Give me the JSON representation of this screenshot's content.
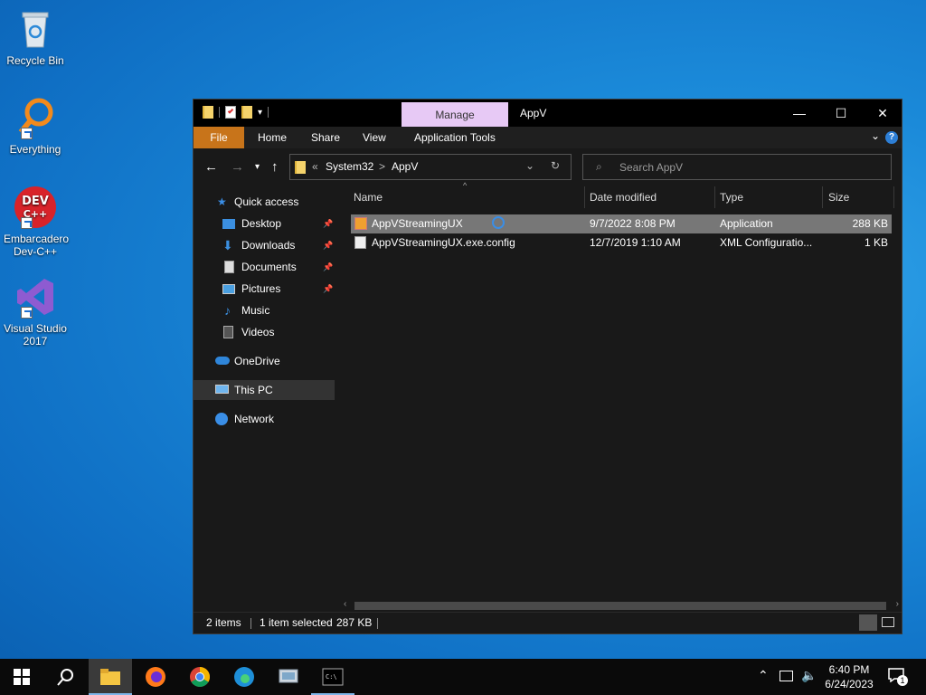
{
  "desktop": {
    "icons": [
      {
        "label": "Recycle Bin",
        "icon": "recycle-bin-icon"
      },
      {
        "label": "Everything",
        "icon": "everything-search-icon"
      },
      {
        "label": "Embarcadero Dev-C++",
        "icon": "devcpp-icon",
        "badge": "DEV C++"
      },
      {
        "label": "Visual Studio 2017",
        "icon": "visual-studio-icon"
      }
    ]
  },
  "window": {
    "title": "AppV",
    "context_tab": "Manage",
    "ribbon_tabs": [
      "File",
      "Home",
      "Share",
      "View",
      "Application Tools"
    ],
    "help": "?",
    "address": {
      "overflow": "«",
      "crumbs": [
        "System32",
        "AppV"
      ],
      "separator": ">"
    },
    "search_placeholder": "Search AppV",
    "nav": {
      "quick_access": "Quick access",
      "items": [
        {
          "label": "Desktop",
          "pinned": true
        },
        {
          "label": "Downloads",
          "pinned": true
        },
        {
          "label": "Documents",
          "pinned": true
        },
        {
          "label": "Pictures",
          "pinned": true
        },
        {
          "label": "Music",
          "pinned": false
        },
        {
          "label": "Videos",
          "pinned": false
        }
      ],
      "onedrive": "OneDrive",
      "thispc": "This PC",
      "network": "Network"
    },
    "columns": [
      "Name",
      "Date modified",
      "Type",
      "Size"
    ],
    "files": [
      {
        "name": "AppVStreamingUX",
        "date": "9/7/2022 8:08 PM",
        "type": "Application",
        "size": "288 KB",
        "selected": true
      },
      {
        "name": "AppVStreamingUX.exe.config",
        "date": "12/7/2019 1:10 AM",
        "type": "XML Configuratio...",
        "size": "1 KB",
        "selected": false
      }
    ],
    "status": {
      "items": "2 items",
      "selected": "1 item selected",
      "size": "287 KB"
    }
  },
  "taskbar": {
    "time": "6:40 PM",
    "date": "6/24/2023",
    "notification_count": "1",
    "apps": [
      "file-explorer-icon",
      "firefox-icon",
      "chrome-icon",
      "edge-icon",
      "network-app-icon",
      "terminal-icon"
    ]
  },
  "colors": {
    "accent_file_tab": "#c8741a",
    "manage_tab": "#e7c9f5",
    "selection": "#777777"
  }
}
